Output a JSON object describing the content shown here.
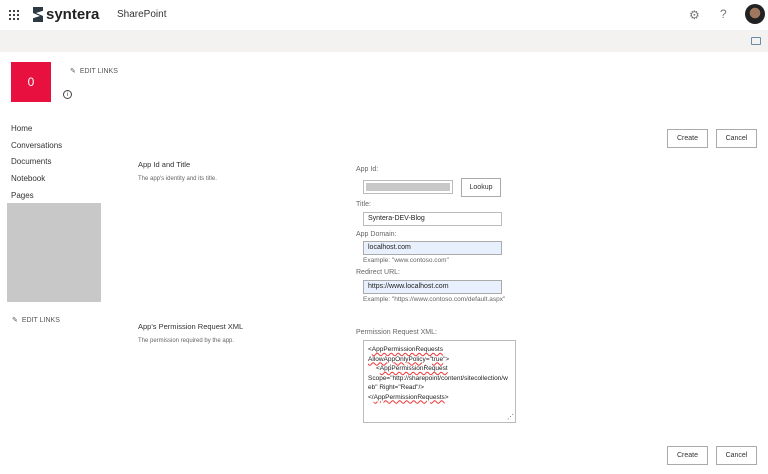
{
  "header": {
    "brand": "syntera",
    "app": "SharePoint",
    "icons": [
      "waffle-icon",
      "gear-icon",
      "help-icon",
      "avatar"
    ],
    "help_glyph": "?"
  },
  "site": {
    "tile_letter": "0",
    "tile_color": "#e8103f",
    "edit_links": "EDIT LINKS"
  },
  "nav": {
    "items": [
      "Home",
      "Conversations",
      "Documents",
      "Notebook",
      "Pages"
    ],
    "edit_links": "EDIT LINKS"
  },
  "actions": {
    "create": "Create",
    "cancel": "Cancel"
  },
  "sections": [
    {
      "title": "App Id and Title",
      "description": "The app's identity and its title."
    },
    {
      "title": "App's Permission Request XML",
      "description": "The permission required by the app."
    }
  ],
  "form": {
    "app_id": {
      "label": "App Id:",
      "value": "",
      "lookup": "Lookup"
    },
    "title": {
      "label": "Title:",
      "value": "Syntera-DEV-Blog"
    },
    "app_domain": {
      "label": "App Domain:",
      "value": "localhost.com",
      "example": "Example: \"www.contoso.com\""
    },
    "redirect_url": {
      "label": "Redirect URL:",
      "value": "https://www.localhost.com",
      "example": "Example: \"https://www.contoso.com/default.aspx\""
    },
    "xml": {
      "label": "Permission Request XML:",
      "parts": [
        "<",
        "AppPermissionRequests",
        "AllowAppOnlyPolicy",
        "=\"",
        "true",
        "\">",
        "<",
        "AppPermissionRequest",
        "Scope=\"http://sharepoint/content/sitecollection/web\" Right=\"Read\"/>",
        "</",
        "AppPermissionRequests",
        ">"
      ]
    }
  }
}
